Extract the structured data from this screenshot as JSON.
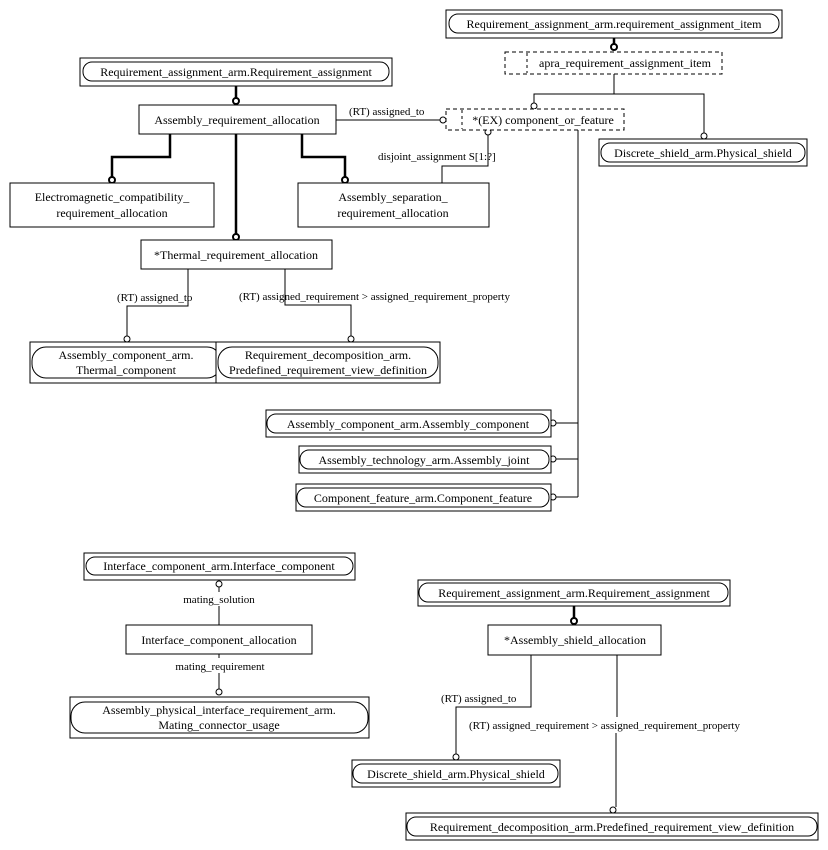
{
  "diagram": {
    "type": "EXPRESS-G schema diagram",
    "entities": {
      "ra_item": "Requirement_assignment_arm.requirement_assignment_item",
      "apra_item": "apra_requirement_assignment_item",
      "ra_top": "Requirement_assignment_arm.Requirement_assignment",
      "asm_req_alloc": "Assembly_requirement_allocation",
      "comp_or_feat": "*(EX) component_or_feature",
      "ds_shield_top": "Discrete_shield_arm.Physical_shield",
      "emc_line1": "Electromagnetic_compatibility_",
      "emc_line2": "requirement_allocation",
      "asep_line1": "Assembly_separation_",
      "asep_line2": "requirement_allocation",
      "thermal": "*Thermal_requirement_allocation",
      "thermal_comp_line1": "Assembly_component_arm.",
      "thermal_comp_line2": "Thermal_component",
      "rd_line1": "Requirement_decomposition_arm.",
      "rd_line2": "Predefined_requirement_view_definition",
      "asm_comp": "Assembly_component_arm.Assembly_component",
      "asm_joint": "Assembly_technology_arm.Assembly_joint",
      "comp_feat": "Component_feature_arm.Component_feature",
      "ifc_comp": "Interface_component_arm.Interface_component",
      "ifc_alloc": "Interface_component_allocation",
      "apir_line1": "Assembly_physical_interface_requirement_arm.",
      "apir_line2": "Mating_connector_usage",
      "ra_bottom": "Requirement_assignment_arm.Requirement_assignment",
      "shield_alloc": "*Assembly_shield_allocation",
      "ds_shield_bottom": "Discrete_shield_arm.Physical_shield",
      "rd_bottom": "Requirement_decomposition_arm.Predefined_requirement_view_definition"
    },
    "relations": {
      "assigned_to_top": "(RT) assigned_to",
      "disjoint": "disjoint_assignment S[1:?]",
      "thermal_assigned_to": "(RT) assigned_to",
      "thermal_assigned_req": "(RT) assigned_requirement > assigned_requirement_property",
      "mating_solution": "mating_solution",
      "mating_requirement": "mating_requirement",
      "shield_assigned_to": "(RT) assigned_to",
      "shield_assigned_req": "(RT) assigned_requirement > assigned_requirement_property"
    }
  }
}
